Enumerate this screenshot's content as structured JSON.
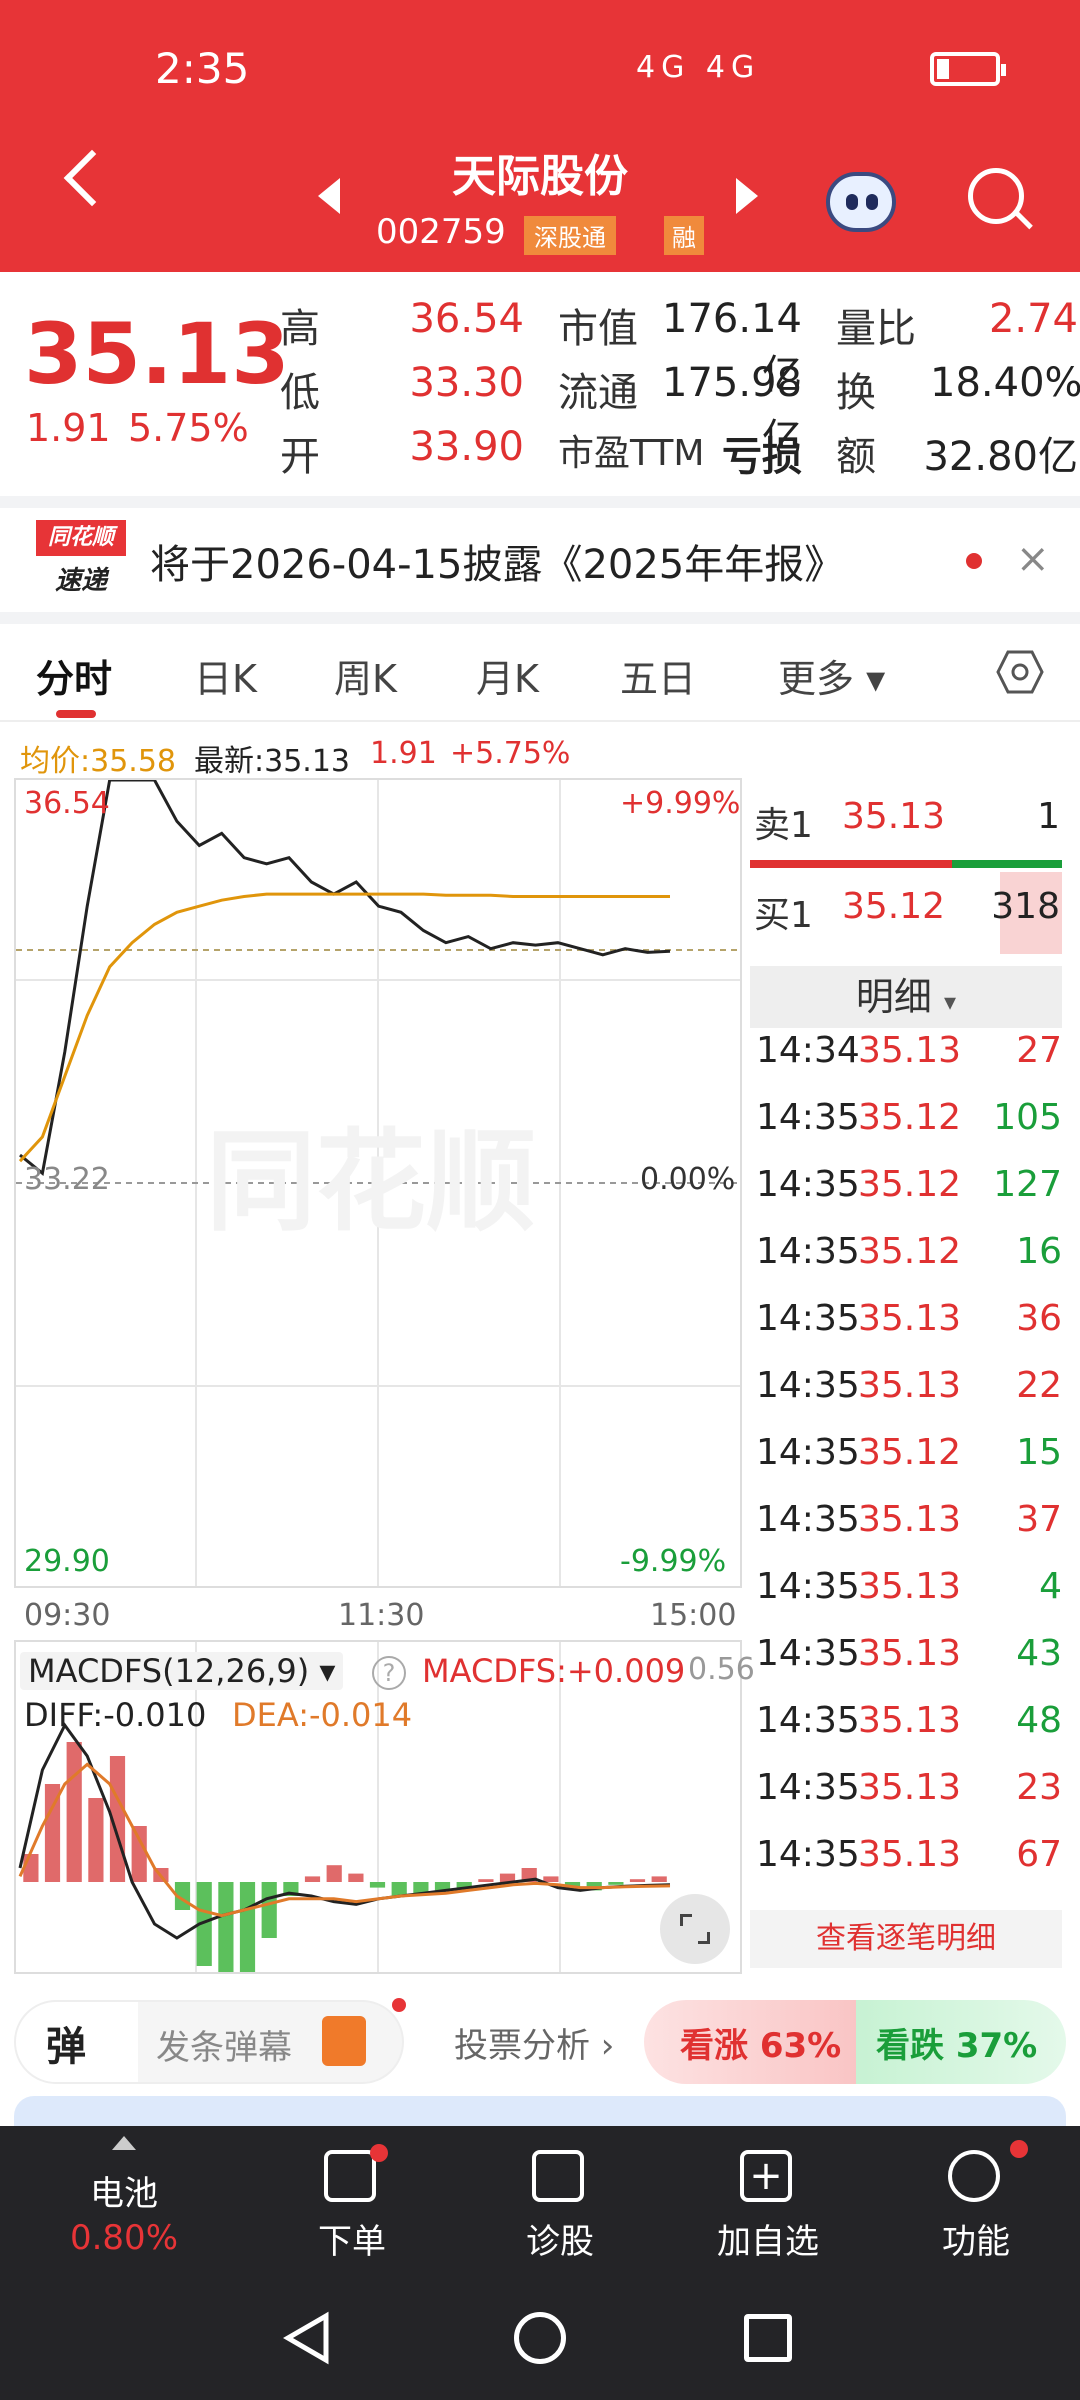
{
  "status_bar": {
    "time": "2:35",
    "icons": "4G 4G"
  },
  "header": {
    "stock_name": "天际股份",
    "stock_code": "002759",
    "tag_connect": "深股通",
    "tag_margin": "融"
  },
  "quote": {
    "price": "35.13",
    "change": "1.91",
    "change_pct": "5.75%",
    "high_label": "高",
    "high": "36.54",
    "low_label": "低",
    "low": "33.30",
    "open_label": "开",
    "open": "33.90",
    "mcap_label": "市值",
    "mcap": "176.14亿",
    "float_label": "流通",
    "float": "175.98亿",
    "pe_label": "市盈TTM",
    "pe": "亏损",
    "vol_ratio_label": "量比",
    "vol_ratio": "2.74",
    "turnover_label": "换",
    "turnover": "18.40%",
    "amount_label": "额",
    "amount": "32.80亿"
  },
  "notice": {
    "logo_top": "同花顺",
    "logo_bottom": "速递",
    "text": "将于2026-04-15披露《2025年年报》"
  },
  "tabs": [
    "分时",
    "日K",
    "周K",
    "月K",
    "五日",
    "更多"
  ],
  "chart_legend": {
    "avg": "均价:35.58",
    "latest": "最新:35.13",
    "change": "1.91",
    "pct": "+5.75%"
  },
  "chart_data": {
    "type": "line",
    "x_ticks": [
      "09:30",
      "11:30",
      "15:00"
    ],
    "y_left_ticks": [
      "36.54",
      "33.22",
      "29.90"
    ],
    "y_right_ticks": [
      "+9.99%",
      "0.00%",
      "-9.99%"
    ],
    "ylim": [
      29.9,
      36.54
    ],
    "prev_close": 33.22,
    "watermark": "同花顺",
    "series": [
      {
        "name": "最新",
        "color": "#222222",
        "values": [
          33.45,
          33.3,
          34.3,
          35.5,
          36.54,
          36.54,
          36.54,
          36.2,
          36.0,
          36.1,
          35.9,
          35.85,
          35.9,
          35.7,
          35.6,
          35.7,
          35.5,
          35.45,
          35.3,
          35.2,
          35.25,
          35.15,
          35.2,
          35.18,
          35.2,
          35.15,
          35.1,
          35.15,
          35.12,
          35.13
        ]
      },
      {
        "name": "均价",
        "color": "#e0950b",
        "values": [
          33.4,
          33.6,
          34.1,
          34.6,
          35.0,
          35.2,
          35.35,
          35.45,
          35.5,
          35.55,
          35.58,
          35.6,
          35.6,
          35.6,
          35.6,
          35.6,
          35.6,
          35.6,
          35.6,
          35.59,
          35.59,
          35.59,
          35.58,
          35.58,
          35.58,
          35.58,
          35.58,
          35.58,
          35.58,
          35.58
        ]
      }
    ]
  },
  "macd": {
    "title": "MACDFS(12,26,9)",
    "value": "MACDFS:+0.009",
    "diff": "DIFF:-0.010",
    "dea": "DEA:-0.014",
    "right_tick": "0.56",
    "hist": [
      0.1,
      0.35,
      0.5,
      0.3,
      0.45,
      0.2,
      0.05,
      -0.1,
      -0.3,
      -0.55,
      -0.45,
      -0.2,
      -0.05,
      0.02,
      0.06,
      0.03,
      -0.02,
      -0.05,
      -0.04,
      -0.03,
      -0.02,
      0.01,
      0.03,
      0.05,
      0.02,
      -0.02,
      -0.03,
      -0.01,
      0.01,
      0.02
    ],
    "diff_values": [
      0.05,
      0.4,
      0.56,
      0.45,
      0.25,
      0.0,
      -0.15,
      -0.2,
      -0.15,
      -0.12,
      -0.1,
      -0.06,
      -0.04,
      -0.05,
      -0.07,
      -0.08,
      -0.06,
      -0.05,
      -0.04,
      -0.03,
      -0.02,
      -0.01,
      0.0,
      0.01,
      -0.02,
      -0.03,
      -0.02,
      -0.015,
      -0.012,
      -0.01
    ],
    "dea_values": [
      0.02,
      0.2,
      0.35,
      0.42,
      0.35,
      0.2,
      0.05,
      -0.05,
      -0.1,
      -0.12,
      -0.1,
      -0.08,
      -0.06,
      -0.06,
      -0.06,
      -0.07,
      -0.06,
      -0.05,
      -0.045,
      -0.04,
      -0.03,
      -0.02,
      -0.01,
      -0.005,
      -0.01,
      -0.02,
      -0.02,
      -0.017,
      -0.015,
      -0.014
    ]
  },
  "order_book": {
    "sell_label": "卖1",
    "sell_price": "35.13",
    "sell_qty": "1",
    "buy_label": "买1",
    "buy_price": "35.12",
    "buy_qty": "318"
  },
  "detail": {
    "header": "明细",
    "footer": "查看逐笔明细",
    "rows": [
      {
        "time": "14:34",
        "price": "35.13",
        "qty": "27",
        "dir": "up"
      },
      {
        "time": "14:35",
        "price": "35.12",
        "qty": "105",
        "dir": "down"
      },
      {
        "time": "14:35",
        "price": "35.12",
        "qty": "127",
        "dir": "down"
      },
      {
        "time": "14:35",
        "price": "35.12",
        "qty": "16",
        "dir": "down"
      },
      {
        "time": "14:35",
        "price": "35.13",
        "qty": "36",
        "dir": "up"
      },
      {
        "time": "14:35",
        "price": "35.13",
        "qty": "22",
        "dir": "up"
      },
      {
        "time": "14:35",
        "price": "35.12",
        "qty": "15",
        "dir": "down"
      },
      {
        "time": "14:35",
        "price": "35.13",
        "qty": "37",
        "dir": "up"
      },
      {
        "time": "14:35",
        "price": "35.13",
        "qty": "4",
        "dir": "down"
      },
      {
        "time": "14:35",
        "price": "35.13",
        "qty": "43",
        "dir": "down"
      },
      {
        "time": "14:35",
        "price": "35.13",
        "qty": "48",
        "dir": "down"
      },
      {
        "time": "14:35",
        "price": "35.13",
        "qty": "23",
        "dir": "up"
      },
      {
        "time": "14:35",
        "price": "35.13",
        "qty": "67",
        "dir": "up"
      }
    ]
  },
  "actions": {
    "danmu_icon": "弹",
    "danmu_text": "发条弹幕",
    "vote_label": "投票分析 ›",
    "vote_up": "看涨 63%",
    "vote_down": "看跌 37%"
  },
  "bottom_nav": {
    "battery_label": "电池",
    "battery_pct": "0.80%",
    "order": "下单",
    "diagnose": "诊股",
    "add_watch": "加自选",
    "functions": "功能"
  },
  "colors": {
    "brand": "#e73437",
    "up": "#e03131",
    "down": "#1a9e3a",
    "avg": "#e0950b"
  }
}
